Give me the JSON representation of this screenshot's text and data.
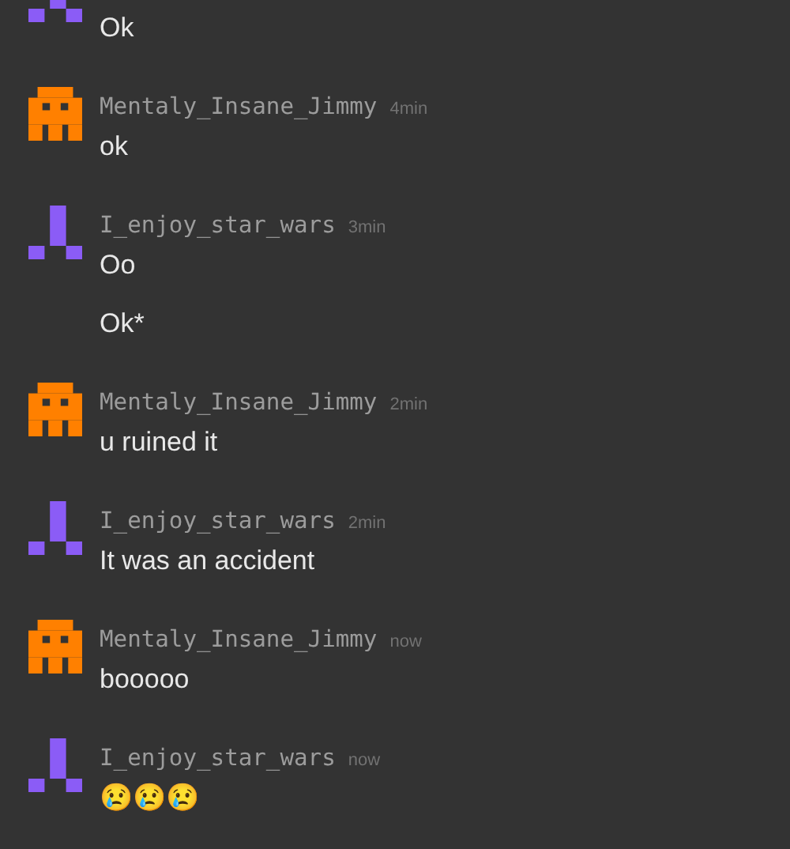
{
  "messages": [
    {
      "avatar": {
        "kind": "tripod",
        "color": "#8b5cf6"
      },
      "lines": [
        "Ok"
      ]
    },
    {
      "author": "Mentaly_Insane_Jimmy",
      "time": "4min",
      "avatar": {
        "kind": "ghost",
        "color": "#ff8000"
      },
      "lines": [
        "ok"
      ]
    },
    {
      "author": "I_enjoy_star_wars",
      "time": "3min",
      "avatar": {
        "kind": "tripod",
        "color": "#8b5cf6"
      },
      "lines": [
        "Oo",
        "Ok*"
      ]
    },
    {
      "author": "Mentaly_Insane_Jimmy",
      "time": "2min",
      "avatar": {
        "kind": "ghost",
        "color": "#ff8000"
      },
      "lines": [
        "u ruined it"
      ]
    },
    {
      "author": "I_enjoy_star_wars",
      "time": "2min",
      "avatar": {
        "kind": "tripod",
        "color": "#8b5cf6"
      },
      "lines": [
        "It was an accident"
      ]
    },
    {
      "author": "Mentaly_Insane_Jimmy",
      "time": "now",
      "avatar": {
        "kind": "ghost",
        "color": "#ff8000"
      },
      "lines": [
        "booooo"
      ]
    },
    {
      "author": "I_enjoy_star_wars",
      "time": "now",
      "avatar": {
        "kind": "tripod",
        "color": "#8b5cf6"
      },
      "lines": [
        "😢😢😢"
      ]
    }
  ]
}
